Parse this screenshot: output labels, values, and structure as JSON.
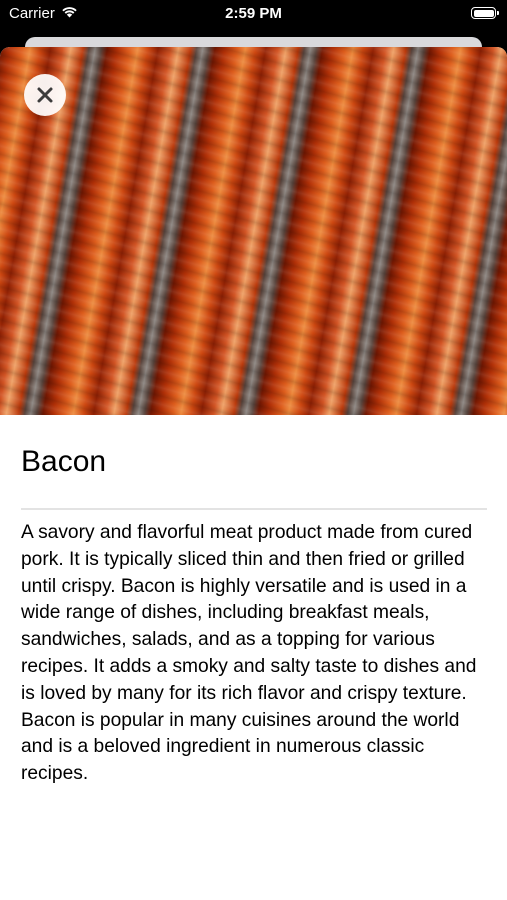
{
  "status_bar": {
    "carrier": "Carrier",
    "time": "2:59 PM"
  },
  "hero": {
    "image": "bacon-photo"
  },
  "detail": {
    "title": "Bacon",
    "description": "A savory and flavorful meat product made from cured pork. It is typically sliced thin and then fried or grilled until crispy. Bacon is highly versatile and is used in a wide range of dishes, including breakfast meals, sandwiches, salads, and as a topping for various recipes. It adds a smoky and salty taste to dishes and is loved by many for its rich flavor and crispy texture. Bacon is popular in many cuisines around the world and is a beloved ingredient in numerous classic recipes."
  },
  "icons": {
    "close": "close-icon",
    "wifi": "wifi-icon",
    "battery": "battery-icon"
  }
}
